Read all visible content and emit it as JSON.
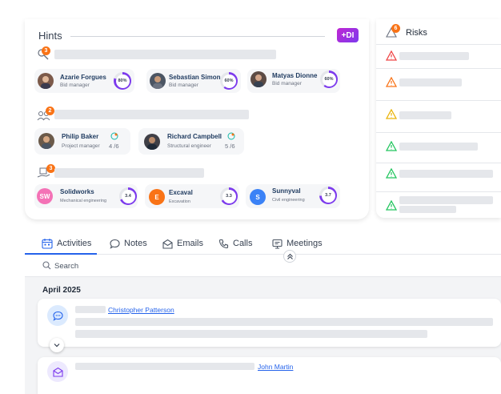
{
  "hints": {
    "title": "Hints",
    "ai_badge": "+DI",
    "groups": [
      {
        "count": "3",
        "people": [
          {
            "name": "Azarie Forgues",
            "role": "Bid manager",
            "match": "80%"
          },
          {
            "name": "Sebastian Simon",
            "role": "Bid manager",
            "match": "60%"
          },
          {
            "name": "Matyas Dionne",
            "role": "Bid manager",
            "match": "60%"
          }
        ]
      },
      {
        "count": "2",
        "people": [
          {
            "name": "Philip Baker",
            "role": "Project manager",
            "score": "4 /6"
          },
          {
            "name": "Richard Campbell",
            "role": "Structural engineer",
            "score": "5 /6"
          }
        ]
      },
      {
        "count": "3",
        "companies": [
          {
            "initials": "SW",
            "name": "Solidworks",
            "role": "Mechanical engineering",
            "rating": "3.4",
            "color": "#f472b6"
          },
          {
            "initials": "E",
            "name": "Excaval",
            "role": "Excavation",
            "rating": "3.3",
            "color": "#f97316"
          },
          {
            "initials": "S",
            "name": "Sunnyval",
            "role": "Civil engineering",
            "rating": "3.7",
            "color": "#3b82f6"
          }
        ]
      }
    ]
  },
  "risks": {
    "title": "Risks",
    "count": "6",
    "levels": [
      "high",
      "high-orange",
      "medium",
      "low",
      "low",
      "low"
    ],
    "colors": {
      "high": "#ef4444",
      "orange": "#f97316",
      "medium": "#eab308",
      "low": "#22c55e"
    }
  },
  "tabs": [
    {
      "label": "Activities",
      "icon": "calendar-icon",
      "active": true
    },
    {
      "label": "Notes",
      "icon": "chat-bubble-icon"
    },
    {
      "label": "Emails",
      "icon": "envelope-icon"
    },
    {
      "label": "Calls",
      "icon": "phone-icon"
    },
    {
      "label": "Meetings",
      "icon": "meeting-icon"
    }
  ],
  "search": {
    "placeholder": "Search"
  },
  "feed": {
    "month": "April 2025",
    "items": [
      {
        "type": "note",
        "contact": "Christopher Patterson"
      },
      {
        "type": "email",
        "contact": "John Martin"
      }
    ]
  },
  "colors": {
    "accent": "#2563eb",
    "ring": "#7c3aed"
  }
}
